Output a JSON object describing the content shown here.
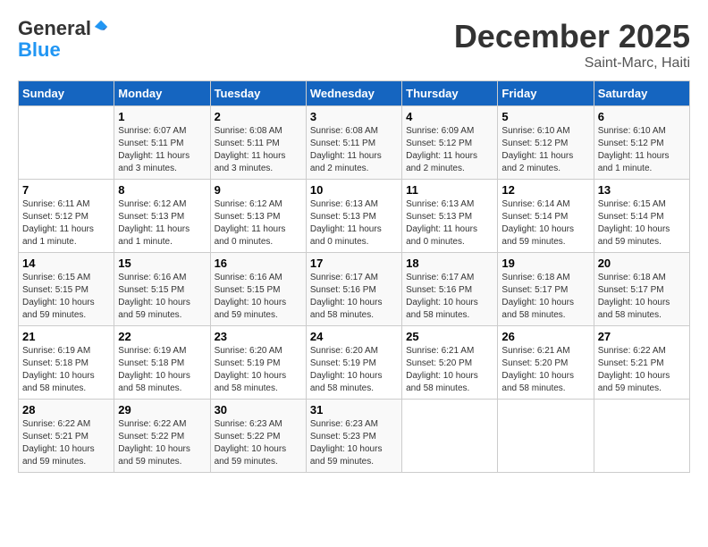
{
  "header": {
    "logo_general": "General",
    "logo_blue": "Blue",
    "main_title": "December 2025",
    "subtitle": "Saint-Marc, Haiti"
  },
  "calendar": {
    "days_of_week": [
      "Sunday",
      "Monday",
      "Tuesday",
      "Wednesday",
      "Thursday",
      "Friday",
      "Saturday"
    ],
    "weeks": [
      [
        {
          "day": "",
          "info": ""
        },
        {
          "day": "1",
          "info": "Sunrise: 6:07 AM\nSunset: 5:11 PM\nDaylight: 11 hours\nand 3 minutes."
        },
        {
          "day": "2",
          "info": "Sunrise: 6:08 AM\nSunset: 5:11 PM\nDaylight: 11 hours\nand 3 minutes."
        },
        {
          "day": "3",
          "info": "Sunrise: 6:08 AM\nSunset: 5:11 PM\nDaylight: 11 hours\nand 2 minutes."
        },
        {
          "day": "4",
          "info": "Sunrise: 6:09 AM\nSunset: 5:12 PM\nDaylight: 11 hours\nand 2 minutes."
        },
        {
          "day": "5",
          "info": "Sunrise: 6:10 AM\nSunset: 5:12 PM\nDaylight: 11 hours\nand 2 minutes."
        },
        {
          "day": "6",
          "info": "Sunrise: 6:10 AM\nSunset: 5:12 PM\nDaylight: 11 hours\nand 1 minute."
        }
      ],
      [
        {
          "day": "7",
          "info": "Sunrise: 6:11 AM\nSunset: 5:12 PM\nDaylight: 11 hours\nand 1 minute."
        },
        {
          "day": "8",
          "info": "Sunrise: 6:12 AM\nSunset: 5:13 PM\nDaylight: 11 hours\nand 1 minute."
        },
        {
          "day": "9",
          "info": "Sunrise: 6:12 AM\nSunset: 5:13 PM\nDaylight: 11 hours\nand 0 minutes."
        },
        {
          "day": "10",
          "info": "Sunrise: 6:13 AM\nSunset: 5:13 PM\nDaylight: 11 hours\nand 0 minutes."
        },
        {
          "day": "11",
          "info": "Sunrise: 6:13 AM\nSunset: 5:13 PM\nDaylight: 11 hours\nand 0 minutes."
        },
        {
          "day": "12",
          "info": "Sunrise: 6:14 AM\nSunset: 5:14 PM\nDaylight: 10 hours\nand 59 minutes."
        },
        {
          "day": "13",
          "info": "Sunrise: 6:15 AM\nSunset: 5:14 PM\nDaylight: 10 hours\nand 59 minutes."
        }
      ],
      [
        {
          "day": "14",
          "info": "Sunrise: 6:15 AM\nSunset: 5:15 PM\nDaylight: 10 hours\nand 59 minutes."
        },
        {
          "day": "15",
          "info": "Sunrise: 6:16 AM\nSunset: 5:15 PM\nDaylight: 10 hours\nand 59 minutes."
        },
        {
          "day": "16",
          "info": "Sunrise: 6:16 AM\nSunset: 5:15 PM\nDaylight: 10 hours\nand 59 minutes."
        },
        {
          "day": "17",
          "info": "Sunrise: 6:17 AM\nSunset: 5:16 PM\nDaylight: 10 hours\nand 58 minutes."
        },
        {
          "day": "18",
          "info": "Sunrise: 6:17 AM\nSunset: 5:16 PM\nDaylight: 10 hours\nand 58 minutes."
        },
        {
          "day": "19",
          "info": "Sunrise: 6:18 AM\nSunset: 5:17 PM\nDaylight: 10 hours\nand 58 minutes."
        },
        {
          "day": "20",
          "info": "Sunrise: 6:18 AM\nSunset: 5:17 PM\nDaylight: 10 hours\nand 58 minutes."
        }
      ],
      [
        {
          "day": "21",
          "info": "Sunrise: 6:19 AM\nSunset: 5:18 PM\nDaylight: 10 hours\nand 58 minutes."
        },
        {
          "day": "22",
          "info": "Sunrise: 6:19 AM\nSunset: 5:18 PM\nDaylight: 10 hours\nand 58 minutes."
        },
        {
          "day": "23",
          "info": "Sunrise: 6:20 AM\nSunset: 5:19 PM\nDaylight: 10 hours\nand 58 minutes."
        },
        {
          "day": "24",
          "info": "Sunrise: 6:20 AM\nSunset: 5:19 PM\nDaylight: 10 hours\nand 58 minutes."
        },
        {
          "day": "25",
          "info": "Sunrise: 6:21 AM\nSunset: 5:20 PM\nDaylight: 10 hours\nand 58 minutes."
        },
        {
          "day": "26",
          "info": "Sunrise: 6:21 AM\nSunset: 5:20 PM\nDaylight: 10 hours\nand 58 minutes."
        },
        {
          "day": "27",
          "info": "Sunrise: 6:22 AM\nSunset: 5:21 PM\nDaylight: 10 hours\nand 59 minutes."
        }
      ],
      [
        {
          "day": "28",
          "info": "Sunrise: 6:22 AM\nSunset: 5:21 PM\nDaylight: 10 hours\nand 59 minutes."
        },
        {
          "day": "29",
          "info": "Sunrise: 6:22 AM\nSunset: 5:22 PM\nDaylight: 10 hours\nand 59 minutes."
        },
        {
          "day": "30",
          "info": "Sunrise: 6:23 AM\nSunset: 5:22 PM\nDaylight: 10 hours\nand 59 minutes."
        },
        {
          "day": "31",
          "info": "Sunrise: 6:23 AM\nSunset: 5:23 PM\nDaylight: 10 hours\nand 59 minutes."
        },
        {
          "day": "",
          "info": ""
        },
        {
          "day": "",
          "info": ""
        },
        {
          "day": "",
          "info": ""
        }
      ]
    ]
  }
}
